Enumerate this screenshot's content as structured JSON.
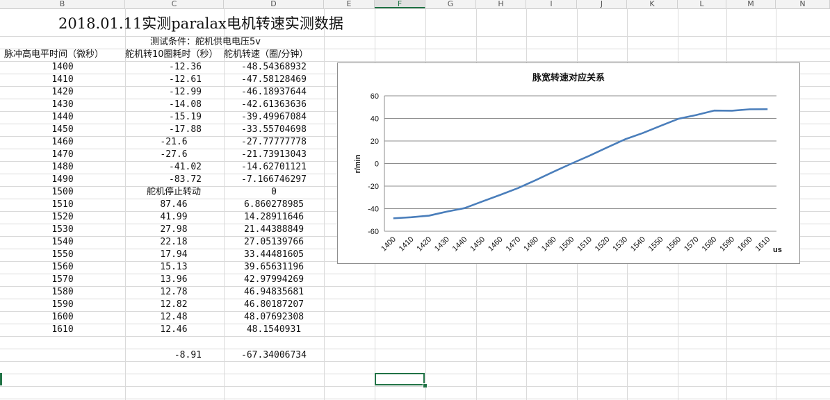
{
  "columns": [
    "B",
    "C",
    "D",
    "E",
    "F",
    "G",
    "H",
    "I",
    "J",
    "K",
    "L",
    "M",
    "N"
  ],
  "active_column": "F",
  "sheet": {
    "title": "2018.01.11实测paralax电机转速实测数据",
    "condition": "测试条件：舵机供电电压5v",
    "headers": [
      "脉冲高电平时间（微秒）",
      "舵机转10圈耗时（秒）",
      "舵机转速（圈/分钟）"
    ],
    "rows": [
      [
        "1400",
        "-12.36",
        "-48.54368932"
      ],
      [
        "1410",
        "-12.61",
        "-47.58128469"
      ],
      [
        "1420",
        "-12.99",
        "-46.18937644"
      ],
      [
        "1430",
        "-14.08",
        "-42.61363636"
      ],
      [
        "1440",
        "-15.19",
        "-39.49967084"
      ],
      [
        "1450",
        "-17.88",
        "-33.55704698"
      ],
      [
        "1460",
        "-21.6",
        "-27.77777778"
      ],
      [
        "1470",
        "-27.6",
        "-21.73913043"
      ],
      [
        "1480",
        "-41.02",
        "-14.62701121"
      ],
      [
        "1490",
        "-83.72",
        "-7.166746297"
      ],
      [
        "1500",
        "舵机停止转动",
        "0"
      ],
      [
        "1510",
        "87.46",
        "6.860278985"
      ],
      [
        "1520",
        "41.99",
        "14.28911646"
      ],
      [
        "1530",
        "27.98",
        "21.44388849"
      ],
      [
        "1540",
        "22.18",
        "27.05139766"
      ],
      [
        "1550",
        "17.94",
        "33.44481605"
      ],
      [
        "1560",
        "15.13",
        "39.65631196"
      ],
      [
        "1570",
        "13.96",
        "42.97994269"
      ],
      [
        "1580",
        "12.78",
        "46.94835681"
      ],
      [
        "1590",
        "12.82",
        "46.80187207"
      ],
      [
        "1600",
        "12.48",
        "48.07692308"
      ],
      [
        "1610",
        "12.46",
        "48.1540931"
      ]
    ],
    "extra_row": [
      "",
      "-8.91",
      "-67.34006734"
    ]
  },
  "chart_data": {
    "type": "line",
    "title": "脉宽转速对应关系",
    "xlabel": "us",
    "ylabel": "r/min",
    "categories": [
      "1400",
      "1410",
      "1420",
      "1430",
      "1440",
      "1450",
      "1460",
      "1470",
      "1480",
      "1490",
      "1500",
      "1510",
      "1520",
      "1530",
      "1540",
      "1550",
      "1560",
      "1570",
      "1580",
      "1590",
      "1600",
      "1610"
    ],
    "series": [
      {
        "values": [
          -48.54,
          -47.58,
          -46.19,
          -42.61,
          -39.5,
          -33.56,
          -27.78,
          -21.74,
          -14.63,
          -7.17,
          0,
          6.86,
          14.29,
          21.44,
          27.05,
          33.44,
          39.66,
          42.98,
          46.95,
          46.8,
          48.08,
          48.15
        ]
      }
    ],
    "ylim": [
      -60,
      60
    ],
    "yticks": [
      "60",
      "40",
      "20",
      "0",
      "-20",
      "-40",
      "-60"
    ],
    "grid": true,
    "line_color": "#4a7ebb"
  }
}
